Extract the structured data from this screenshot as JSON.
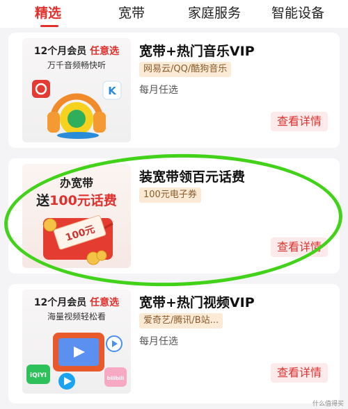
{
  "tabs": [
    "精选",
    "宽带",
    "家庭服务",
    "智能设备"
  ],
  "cards": [
    {
      "thumb_line1_a": "12个月会员",
      "thumb_line1_b": "任意选",
      "thumb_sub": "万千音频畅快听",
      "title": "宽带+热门音乐VIP",
      "tag": "网易云/QQ/酷狗音乐",
      "meta": "每月任选",
      "button": "查看详情",
      "icons": [
        "netease-music-icon",
        "kugou-icon",
        "qq-music-headphone-icon"
      ]
    },
    {
      "thumb_line1": "办宽带",
      "thumb_line2_a": "送",
      "thumb_line2_b": "100元话费",
      "coupon_text": "100元",
      "title": "装宽带领百元话费",
      "tag": "100元电子券",
      "button": "查看详情",
      "icons": [
        "red-envelope-icon",
        "coin-icon"
      ]
    },
    {
      "thumb_line1_a": "12个月会员",
      "thumb_line1_b": "任意选",
      "thumb_sub": "海量视频轻松看",
      "badge_left": "iQIYI",
      "badge_right": "bilibili",
      "title": "宽带+热门视频VIP",
      "tag": "爱奇艺/腾讯/B站...",
      "meta": "每月任选",
      "button": "查看详情",
      "icons": [
        "tv-icon",
        "iqiyi-icon",
        "tencent-video-icon",
        "bilibili-icon"
      ]
    }
  ],
  "watermark": "什么值得买",
  "colors": {
    "accent": "#e0312d",
    "tag_bg": "#fbead5",
    "button_bg": "#fdebeb",
    "annotation": "#43d21a"
  }
}
